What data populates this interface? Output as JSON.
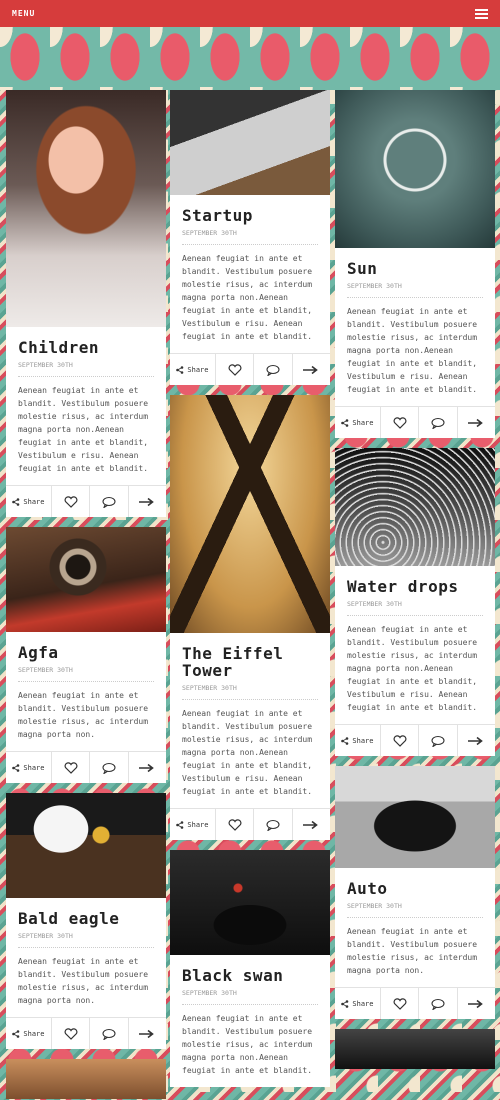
{
  "nav": {
    "menu_label": "MENU",
    "menu_icon": "hamburger-icon"
  },
  "cards": {
    "children": {
      "title": "Children",
      "date": "SEPTEMBER 30TH",
      "text": "Aenean feugiat in ante et blandit. Vestibulum posuere molestie risus, ac interdum magna porta non.Aenean feugiat in ante et blandit, Vestibulum e risu. Aenean feugiat in ante et blandit.",
      "share": "Share"
    },
    "startup": {
      "title": "Startup",
      "date": "SEPTEMBER 30TH",
      "text": "Aenean feugiat in ante et blandit. Vestibulum posuere molestie risus, ac interdum magna porta non.Aenean feugiat in ante et blandit, Vestibulum e risu. Aenean feugiat in ante et blandit.",
      "share": "Share"
    },
    "sun": {
      "title": "Sun",
      "date": "SEPTEMBER 30TH",
      "text": "Aenean feugiat in ante et blandit. Vestibulum posuere molestie risus, ac interdum magna porta non.Aenean feugiat in ante et blandit, Vestibulum e risu. Aenean feugiat in ante et blandit.",
      "share": "Share"
    },
    "agfa": {
      "title": "Agfa",
      "date": "SEPTEMBER 30TH",
      "text": "Aenean feugiat in ante et blandit. Vestibulum posuere molestie risus, ac interdum magna porta non.",
      "share": "Share"
    },
    "eiffel": {
      "title": "The Eiffel Tower",
      "date": "SEPTEMBER 30TH",
      "text": "Aenean feugiat in ante et blandit. Vestibulum posuere molestie risus, ac interdum magna porta non.Aenean feugiat in ante et blandit, Vestibulum e risu. Aenean feugiat in ante et blandit.",
      "share": "Share"
    },
    "water": {
      "title": "Water drops",
      "date": "SEPTEMBER 30TH",
      "text": "Aenean feugiat in ante et blandit. Vestibulum posuere molestie risus, ac interdum magna porta non.Aenean feugiat in ante et blandit, Vestibulum e risu. Aenean feugiat in ante et blandit.",
      "share": "Share"
    },
    "eagle": {
      "title": "Bald eagle",
      "date": "SEPTEMBER 30TH",
      "text": "Aenean feugiat in ante et blandit. Vestibulum posuere molestie risus, ac interdum magna porta non.",
      "share": "Share"
    },
    "swan": {
      "title": "Black swan",
      "date": "SEPTEMBER 30TH",
      "text": "Aenean feugiat in ante et blandit. Vestibulum posuere molestie risus, ac interdum magna porta non.Aenean feugiat in ante et blandit.",
      "share": "Share"
    },
    "auto": {
      "title": "Auto",
      "date": "SEPTEMBER 30TH",
      "text": "Aenean feugiat in ante et blandit. Vestibulum posuere molestie risus, ac interdum magna porta non.",
      "share": "Share"
    }
  },
  "icons": {
    "share": "share-icon",
    "like": "heart-icon",
    "comment": "comment-icon",
    "more": "arrow-right-icon"
  },
  "colors": {
    "topbar": "#d63c3c",
    "card_bg": "#ffffff"
  }
}
